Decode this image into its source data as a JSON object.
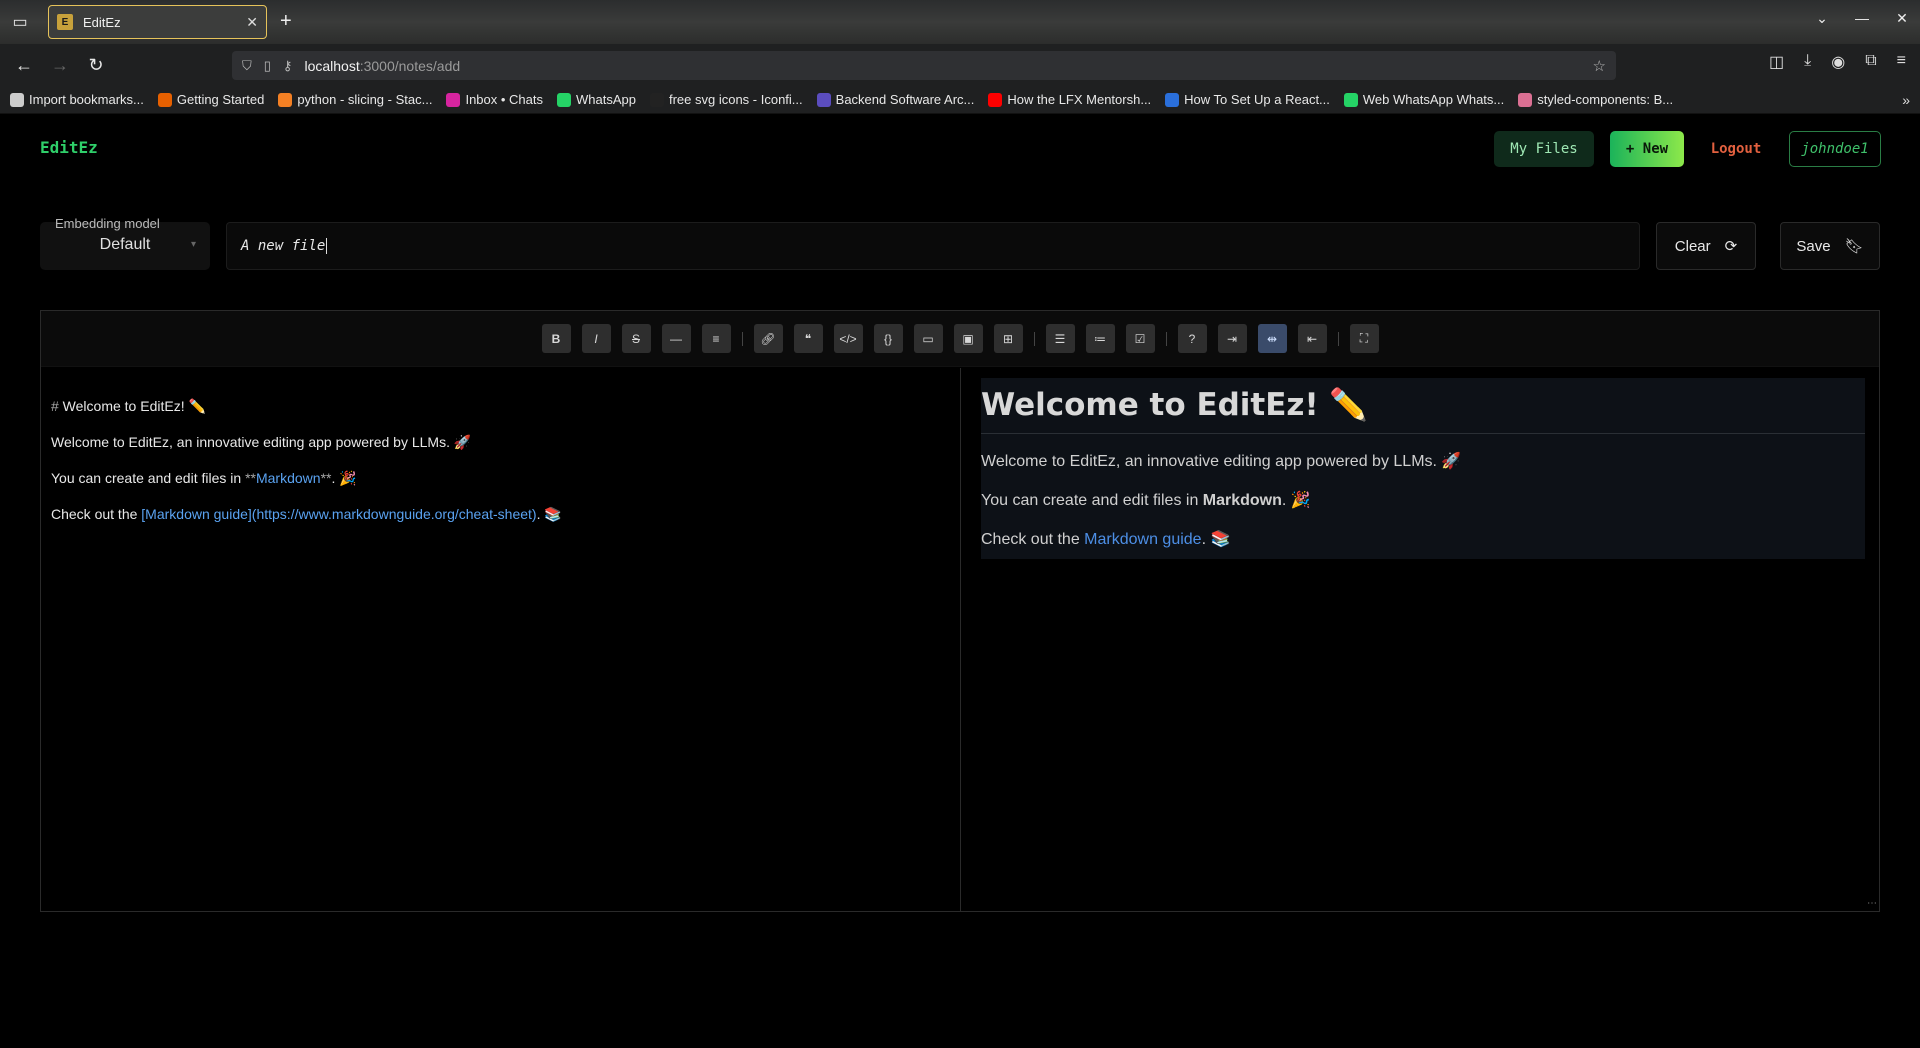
{
  "browser": {
    "tab_title": "EditEz",
    "url_host": "localhost",
    "url_rest": ":3000/notes/add",
    "bookmarks": [
      {
        "label": "Import bookmarks...",
        "color": "#cccccc"
      },
      {
        "label": "Getting Started",
        "color": "#e66000"
      },
      {
        "label": "python - slicing - Stac...",
        "color": "#f48024"
      },
      {
        "label": "Inbox • Chats",
        "color": "#d6249f"
      },
      {
        "label": "WhatsApp",
        "color": "#25d366"
      },
      {
        "label": "free svg icons - Iconfi...",
        "color": "#222222"
      },
      {
        "label": "Backend Software Arc...",
        "color": "#5b4dbf"
      },
      {
        "label": "How the LFX Mentorsh...",
        "color": "#ff0000"
      },
      {
        "label": "How To Set Up a React...",
        "color": "#2a6fdb"
      },
      {
        "label": "Web WhatsApp Whats...",
        "color": "#25d366"
      },
      {
        "label": "styled-components: B...",
        "color": "#db7093"
      }
    ]
  },
  "app": {
    "logo": "EditEz",
    "my_files": "My Files",
    "new": "+ New",
    "logout": "Logout",
    "user": "johndoe1"
  },
  "controls": {
    "model_label": "Embedding model",
    "model_value": "Default",
    "title_value": "A new file",
    "clear": "Clear",
    "save": "Save"
  },
  "toolbar": [
    "B",
    "I",
    "S",
    "H",
    "T",
    "link",
    "quote",
    "code",
    "block",
    "comment",
    "image",
    "table",
    "ul",
    "ol",
    "task",
    "?",
    "r1",
    "split",
    "r2",
    "full"
  ],
  "source": {
    "l1_sym": "#",
    "l1_text": " Welcome to EditEz! ✏️",
    "l2": "Welcome to EditEz, an innovative editing app powered by LLMs. 🚀",
    "l3_pre": "You can create and edit files in ",
    "l3_sym_a": "**",
    "l3_link": "Markdown",
    "l3_sym_b": "**",
    "l3_post": ". 🎉",
    "l4_pre": "Check out the ",
    "l4_link": "[Markdown guide](https://www.markdownguide.org/cheat-sheet)",
    "l4_post": ". 📚"
  },
  "preview": {
    "h1": "Welcome to EditEz! ✏️",
    "p1": "Welcome to EditEz, an innovative editing app powered by LLMs. 🚀",
    "p2_pre": "You can create and edit files in ",
    "p2_bold": "Markdown",
    "p2_post": ". 🎉",
    "p3_pre": "Check out the ",
    "p3_link": "Markdown guide",
    "p3_post": ". 📚"
  }
}
